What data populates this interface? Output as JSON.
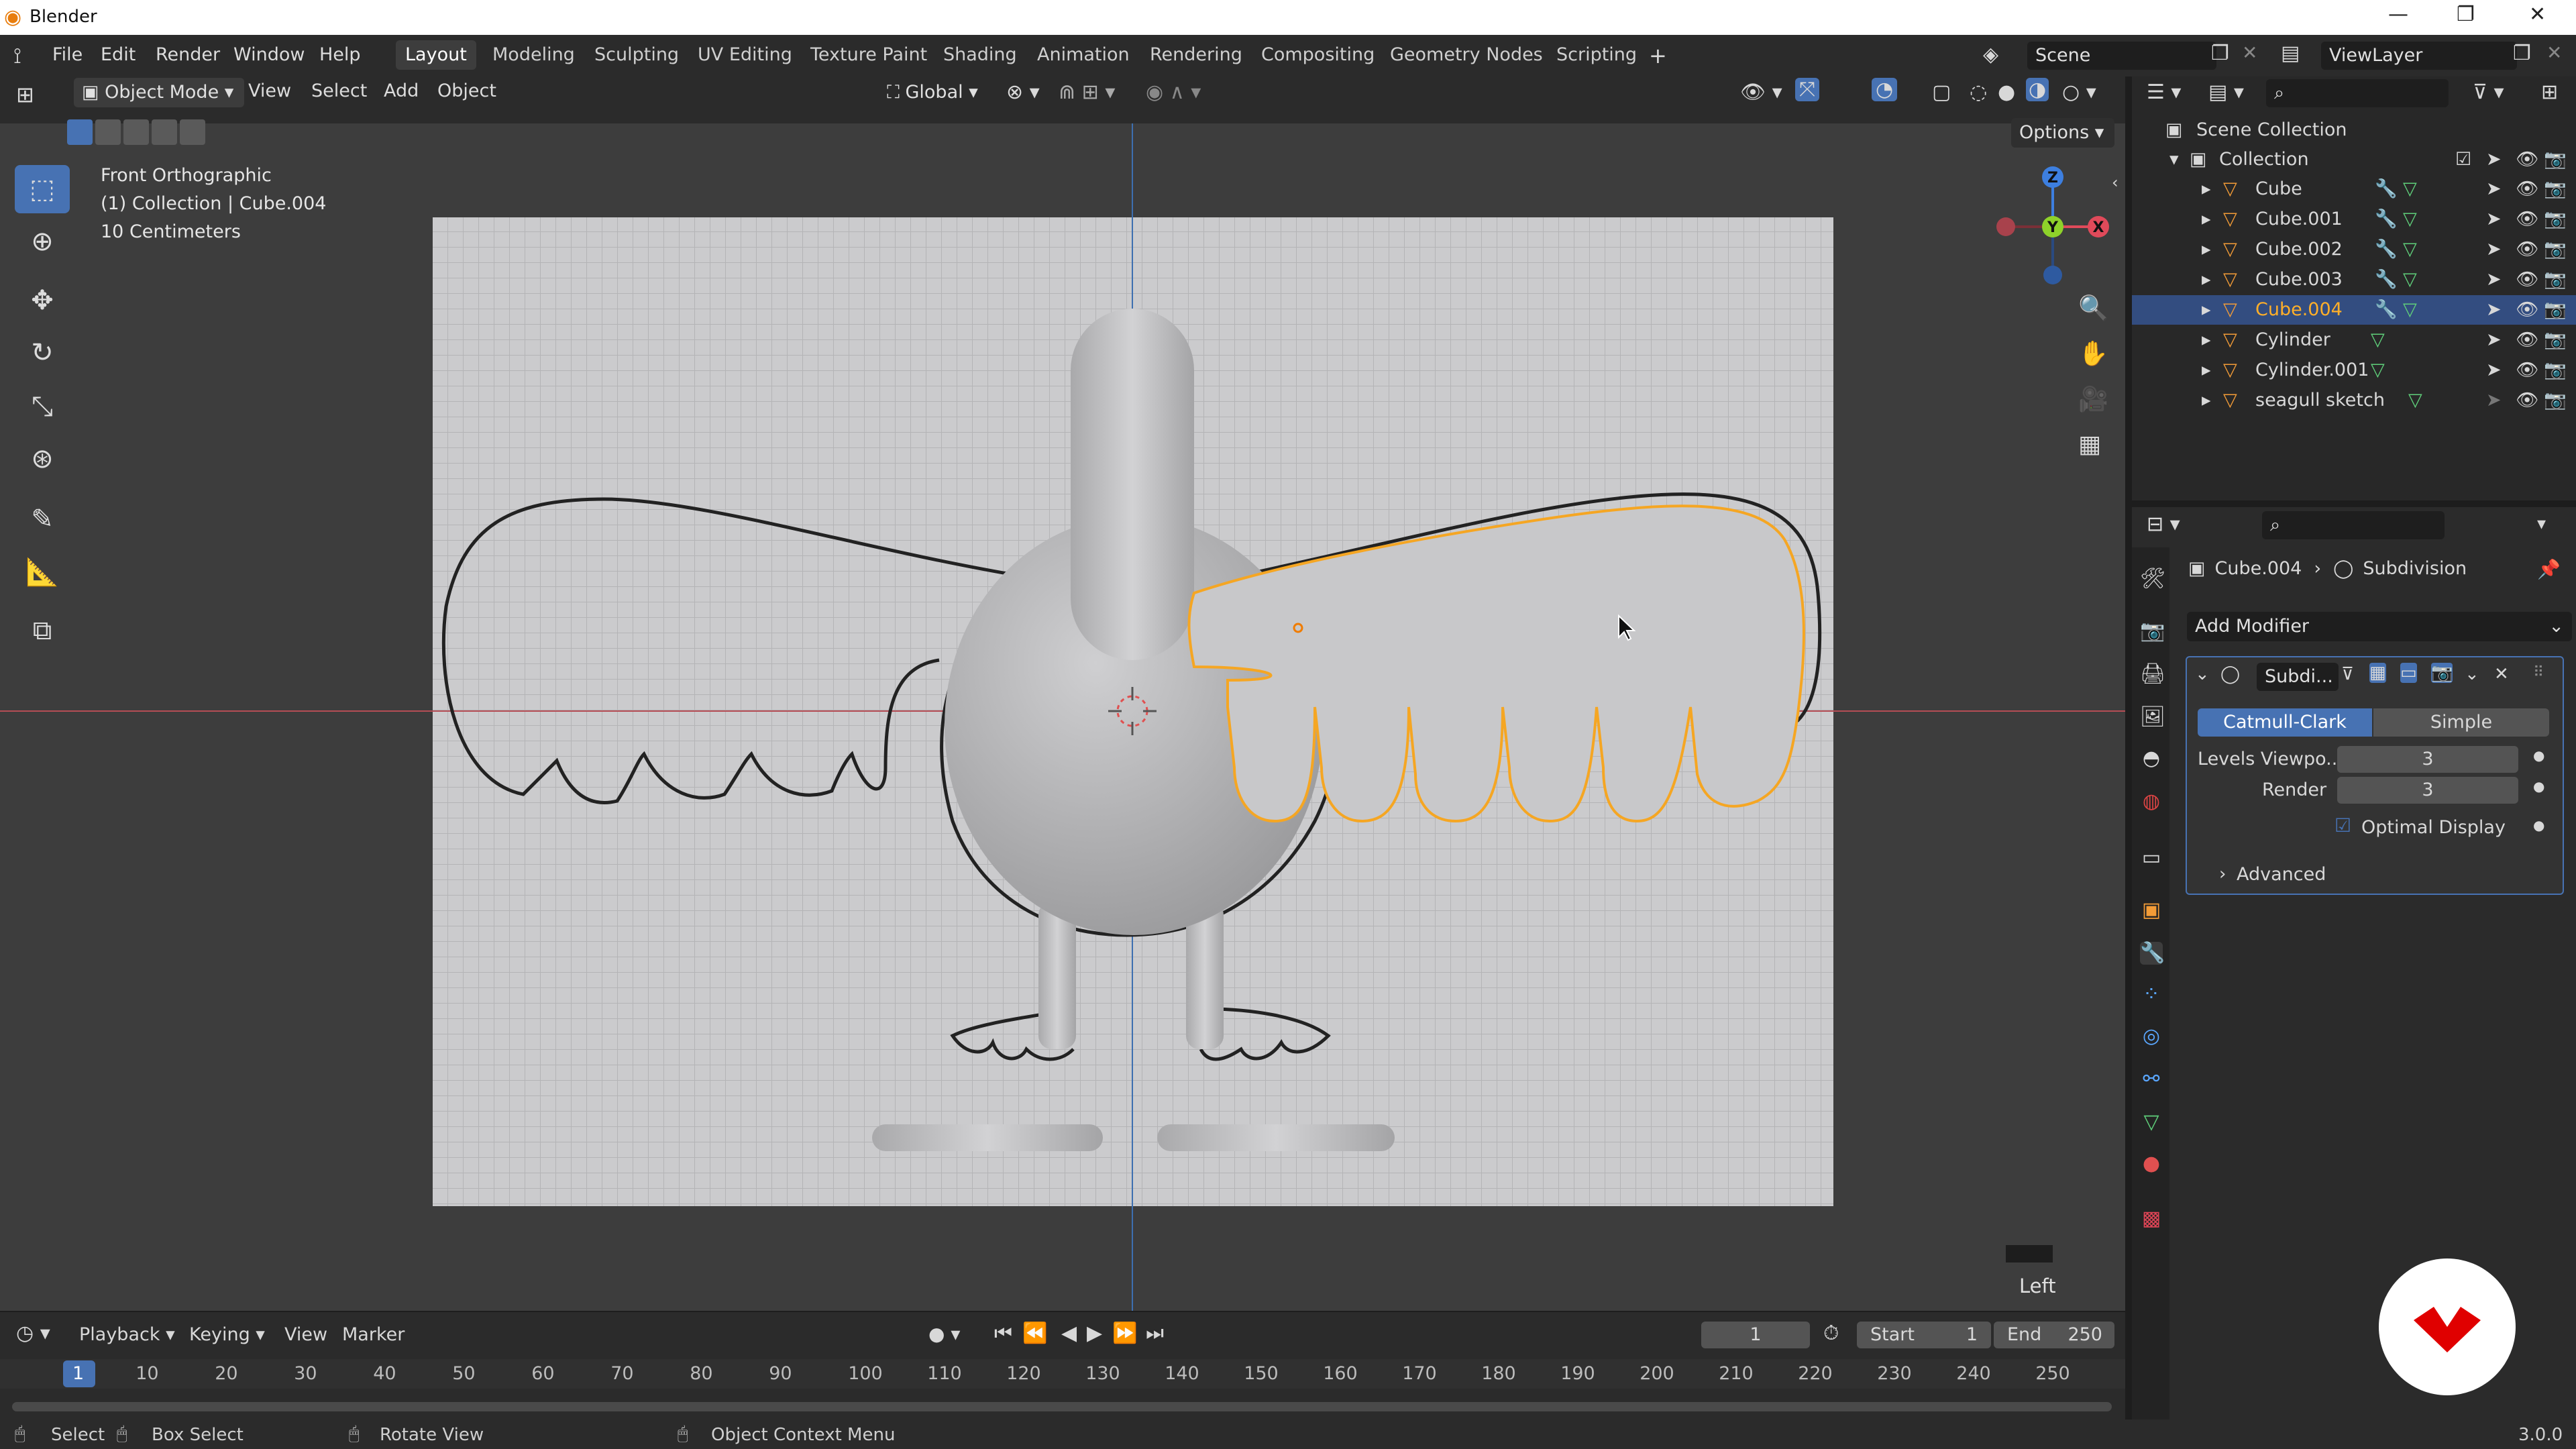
{
  "app_title": "Blender",
  "window_controls": {
    "minimize": "—",
    "restore": "❐",
    "close": "✕"
  },
  "menu": [
    "File",
    "Edit",
    "Render",
    "Window",
    "Help"
  ],
  "workspaces": [
    "Layout",
    "Modeling",
    "Sculpting",
    "UV Editing",
    "Texture Paint",
    "Shading",
    "Animation",
    "Rendering",
    "Compositing",
    "Geometry Nodes",
    "Scripting"
  ],
  "active_workspace": "Layout",
  "scene": "Scene",
  "view_layer": "ViewLayer",
  "viewport_header": {
    "mode": "Object Mode",
    "menus": [
      "View",
      "Select",
      "Add",
      "Object"
    ],
    "transform": "Global",
    "options": "Options"
  },
  "overlay_info": {
    "view": "Front Orthographic",
    "collection": "(1) Collection | Cube.004",
    "scale": "10 Centimeters"
  },
  "gizmo_axes": {
    "z": "Z",
    "y": "Y",
    "x": "X"
  },
  "view_label": "Left",
  "outliner": {
    "root": "Scene Collection",
    "collection": "Collection",
    "items": [
      {
        "name": "Cube",
        "selected": false
      },
      {
        "name": "Cube.001",
        "selected": false
      },
      {
        "name": "Cube.002",
        "selected": false
      },
      {
        "name": "Cube.003",
        "selected": false
      },
      {
        "name": "Cube.004",
        "selected": true
      },
      {
        "name": "Cylinder",
        "selected": false
      },
      {
        "name": "Cylinder.001",
        "selected": false
      },
      {
        "name": "seagull sketch",
        "selected": false
      }
    ]
  },
  "properties": {
    "object": "Cube.004",
    "modifier_name": "Subdivision",
    "add_modifier": "Add Modifier",
    "panel_label": "Subdi...",
    "tab_catmull": "Catmull-Clark",
    "tab_simple": "Simple",
    "levels_label": "Levels Viewpo...",
    "levels_value": "3",
    "render_label": "Render",
    "render_value": "3",
    "optimal_display": "Optimal Display",
    "advanced": "Advanced"
  },
  "timeline": {
    "menus": [
      "Playback",
      "Keying",
      "View",
      "Marker"
    ],
    "current_frame": "1",
    "start_label": "Start",
    "start": "1",
    "end_label": "End",
    "end": "250",
    "ticks": [
      "1",
      "10",
      "20",
      "30",
      "40",
      "50",
      "60",
      "70",
      "80",
      "90",
      "100",
      "110",
      "120",
      "130",
      "140",
      "150",
      "160",
      "170",
      "180",
      "190",
      "200",
      "210",
      "220",
      "230",
      "240",
      "250"
    ]
  },
  "statusbar": {
    "select": "Select",
    "box_select": "Box Select",
    "rotate_view": "Rotate View",
    "context_menu": "Object Context Menu",
    "version": "3.0.0"
  },
  "colors": {
    "accent": "#4772b3",
    "selection_orange": "#f5a623",
    "x_axis": "#e04a5a",
    "y_axis": "#8ed22a",
    "z_axis": "#3d7fe0",
    "logo_red": "#e00000"
  }
}
